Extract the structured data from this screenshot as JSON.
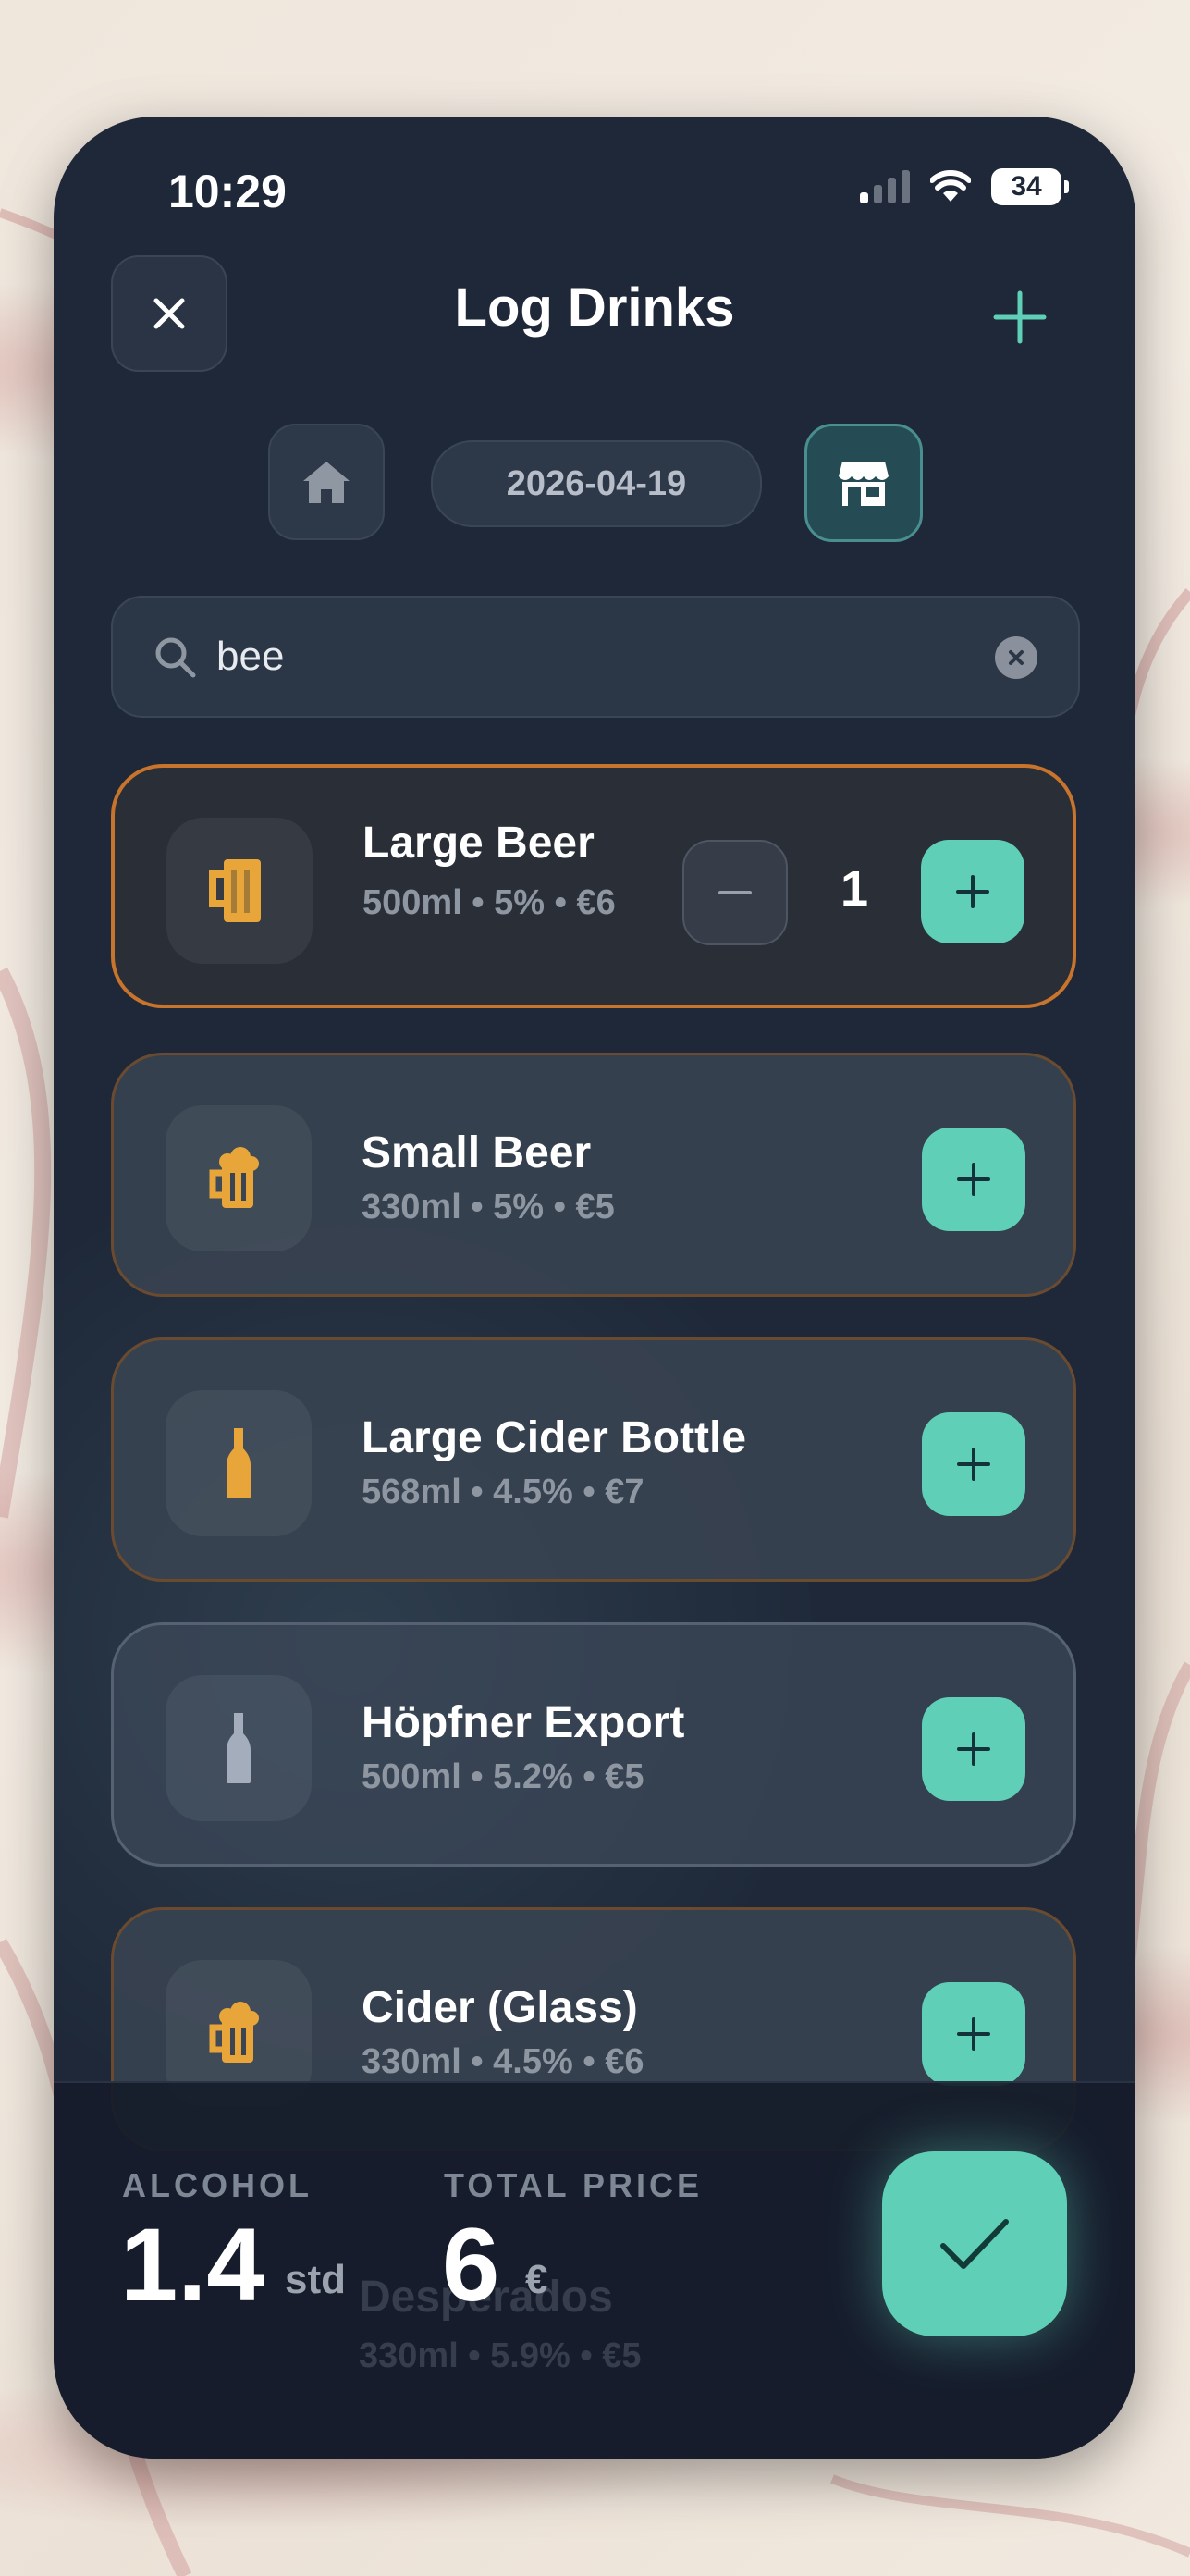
{
  "status_bar": {
    "time": "10:29",
    "battery": "34"
  },
  "header": {
    "title": "Log Drinks"
  },
  "location": {
    "date": "2026-04-19"
  },
  "search": {
    "value": "bee"
  },
  "drinks": [
    {
      "name": "Large Beer",
      "meta": "500ml • 5% • €6",
      "icon": "beer-mug-icon",
      "quantity": "1",
      "selected": true
    },
    {
      "name": "Small Beer",
      "meta": "330ml • 5% • €5",
      "icon": "foamy-beer-mug-icon"
    },
    {
      "name": "Large Cider Bottle",
      "meta": "568ml • 4.5% • €7",
      "icon": "bottle-icon"
    },
    {
      "name": "Höpfner Export",
      "meta": "500ml • 5.2% • €5",
      "icon": "bottle-icon"
    },
    {
      "name": "Cider (Glass)",
      "meta": "330ml • 4.5% • €6",
      "icon": "foamy-beer-mug-icon"
    },
    {
      "name": "Desperados",
      "meta": "330ml • 5.9% • €5",
      "icon": "bottle-icon"
    }
  ],
  "summary": {
    "alcohol_label": "ALCOHOL",
    "alcohol_value": "1.4",
    "alcohol_unit": "std",
    "price_label": "TOTAL PRICE",
    "price_value": "6",
    "price_unit": "€"
  },
  "colors": {
    "accent": "#5fcfb8",
    "selected_border": "#c8742c",
    "icon_amber": "#e7a53a",
    "background": "#1e2838"
  }
}
